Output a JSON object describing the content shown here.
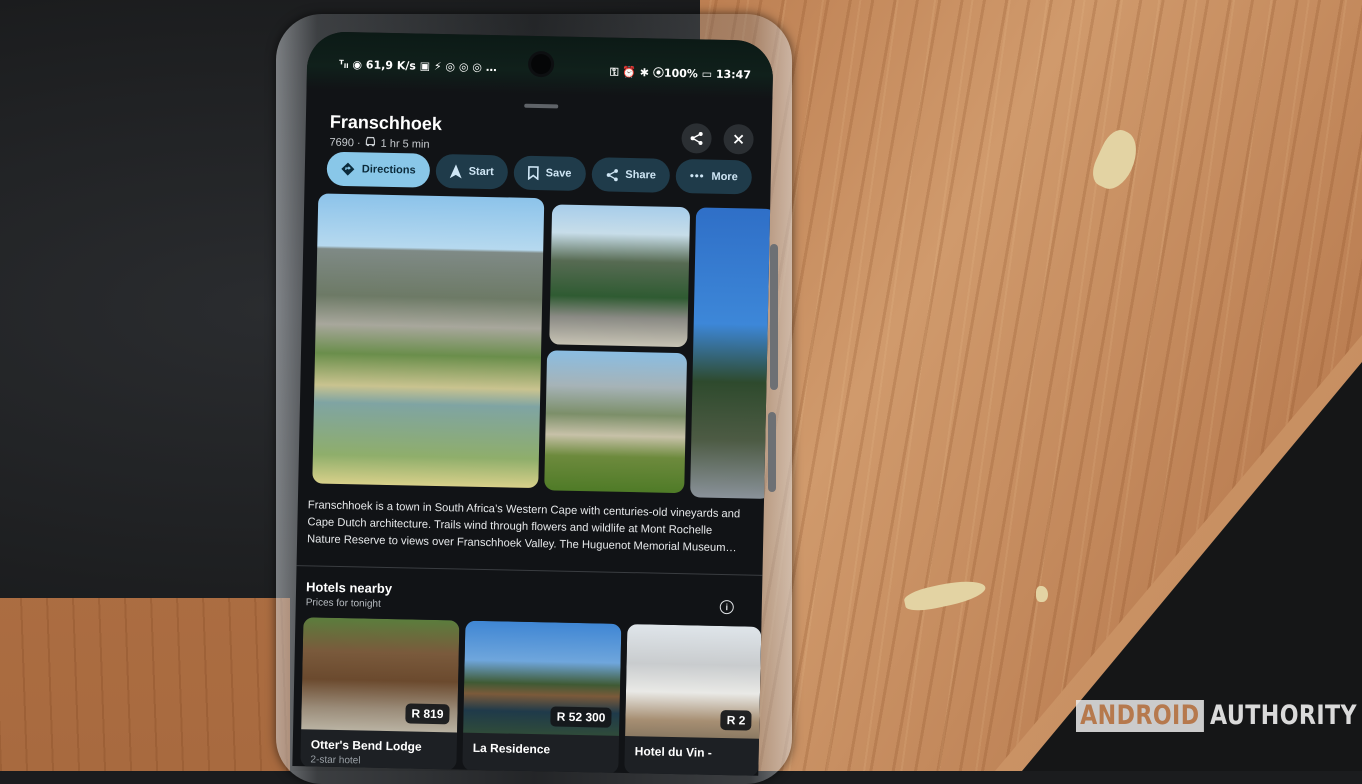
{
  "status_bar": {
    "left": "ᵀₗₗ ◉ 61,9 K/s ▣ ⚡ ◎ ◎ ◎ …",
    "right": "⚿ ⏰ ✱ ⦿100% ▭ 13:47"
  },
  "place": {
    "title": "Franschhoek",
    "meta": "7690 ·",
    "drive_time": "1 hr 5 min"
  },
  "actions": [
    {
      "label": "Directions",
      "icon": "directions-icon"
    },
    {
      "label": "Start",
      "icon": "navigation-arrow-icon"
    },
    {
      "label": "Save",
      "icon": "bookmark-icon"
    },
    {
      "label": "Share",
      "icon": "share-icon"
    },
    {
      "label": "More",
      "icon": "more-dots-icon"
    }
  ],
  "description": "Franschhoek is a town in South Africa’s Western Cape with centuries-old vineyards and Cape Dutch architecture. Trails wind through flowers and wildlife at Mont Rochelle Nature Reserve to views over Franschhoek Valley. The Huguenot Memorial Museum…",
  "hotels": {
    "title": "Hotels nearby",
    "subtitle": "Prices for tonight",
    "items": [
      {
        "name": "Otter's Bend Lodge",
        "price": "R 819",
        "class": "2-star hotel"
      },
      {
        "name": "La Residence",
        "price": "R 52 300",
        "class": ""
      },
      {
        "name": "Hotel du Vin -",
        "price": "R 2",
        "class": ""
      }
    ]
  },
  "watermark": {
    "box": "ANDROID",
    "text": "AUTHORITY"
  },
  "colors": {
    "accent_chip": "#89c7e8",
    "chip_bg": "#1f3b4a",
    "screen_bg": "#111316"
  }
}
